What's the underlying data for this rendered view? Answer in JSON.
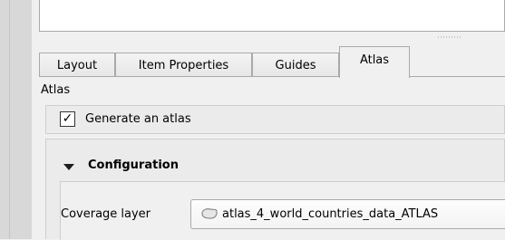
{
  "tabs": [
    {
      "label": "Layout"
    },
    {
      "label": "Item Properties"
    },
    {
      "label": "Guides"
    },
    {
      "label": "Atlas"
    }
  ],
  "section_title": "Atlas",
  "generate": {
    "label": "Generate an atlas",
    "checked": true,
    "check_mark": "✓"
  },
  "configuration": {
    "title": "Configuration",
    "expanded": true
  },
  "coverage": {
    "label": "Coverage layer",
    "value": "atlas_4_world_countries_data_ATLAS",
    "icon": "polygon-layer-icon"
  }
}
